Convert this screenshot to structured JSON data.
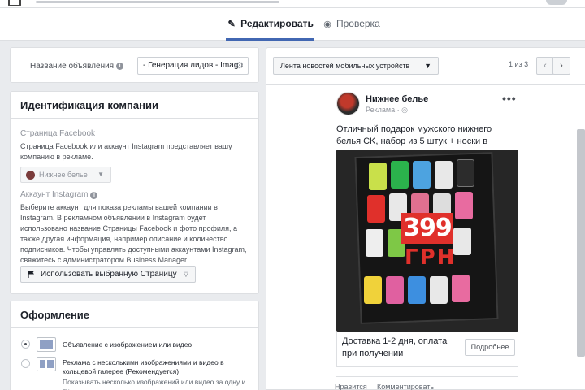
{
  "tabs": {
    "edit_label": "Редактировать",
    "preview_label": "Проверка"
  },
  "ad_name": {
    "label": "Название объявления",
    "value": "- Генерация лидов - Imag"
  },
  "identity": {
    "title": "Идентификация компании",
    "facebook_label": "Страница Facebook",
    "facebook_desc": "Страница Facebook или аккаунт Instagram представляет вашу компанию в рекламе.",
    "page_select": "Нижнее белье",
    "instagram_label": "Аккаунт Instagram",
    "instagram_desc": "Выберите аккаунт для показа рекламы вашей компании в Instagram. В рекламном объявлении в Instagram будет использовано название Страницы Facebook и фото профиля, а также другая информация, например описание и количество подписчиков. Чтобы управлять доступными аккаунтами Instagram, свяжитесь с администратором Business Manager.",
    "use_page_button": "Использовать выбранную Страницу"
  },
  "design": {
    "title": "Оформление",
    "option1": "Объявление с изображением или видео",
    "option2": "Реклама с несколькими изображениями и видео в кольцевой галерее (Рекомендуется)",
    "option2_desc": "Показывать несколько изображений или видео за одну и ту"
  },
  "preview": {
    "placement": "Лента новостей мобильных устройств",
    "pager": "1 из 3",
    "page_name": "Нижнее белье",
    "sponsored": "Реклама",
    "post_text": "Отличный подарок мужского нижнего белья CK, набор из 5 штук + носки в подарок",
    "price": "399",
    "currency": "ГРН",
    "cta_text": "Доставка 1-2 дня, оплата при получении",
    "cta_button": "Подробнее",
    "like": "Нравится",
    "comment": "Комментировать"
  },
  "colors": {
    "accent": "#4267b2",
    "background": "#e9ebee",
    "price_badge": "#e0302b"
  }
}
